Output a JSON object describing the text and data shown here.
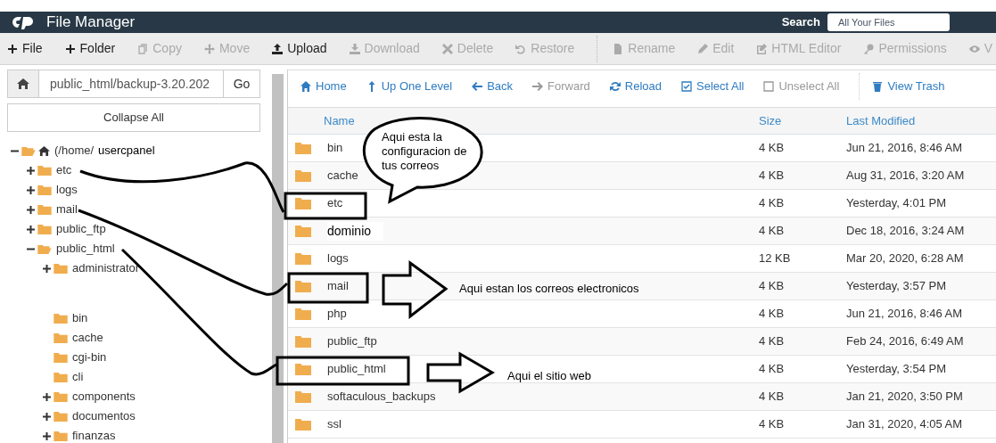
{
  "header": {
    "title": "File Manager",
    "search_label": "Search",
    "search_scope": "All Your Files"
  },
  "toolbar": [
    {
      "label": "File",
      "disabled": false
    },
    {
      "label": "Folder",
      "disabled": false
    },
    {
      "label": "Copy",
      "disabled": true
    },
    {
      "label": "Move",
      "disabled": true
    },
    {
      "label": "Upload",
      "disabled": false
    },
    {
      "label": "Download",
      "disabled": true
    },
    {
      "label": "Delete",
      "disabled": true
    },
    {
      "label": "Restore",
      "disabled": true
    },
    {
      "label": "Rename",
      "disabled": true
    },
    {
      "label": "Edit",
      "disabled": true
    },
    {
      "label": "HTML Editor",
      "disabled": true
    },
    {
      "label": "Permissions",
      "disabled": true
    },
    {
      "label": "V",
      "disabled": true
    }
  ],
  "path_field": {
    "value": "public_html/backup-3.20.202",
    "go": "Go"
  },
  "collapse_all": "Collapse All",
  "tree": {
    "label": "(/home/",
    "user": "usercpanel",
    "kind": "expanded",
    "children": [
      {
        "label": "etc",
        "kind": "collapsed"
      },
      {
        "label": "logs",
        "kind": "collapsed"
      },
      {
        "label": "mail",
        "kind": "collapsed"
      },
      {
        "label": "public_ftp",
        "kind": "collapsed"
      },
      {
        "label": "public_html",
        "kind": "expanded",
        "children": [
          {
            "label": "administrator",
            "kind": "collapsed"
          },
          {
            "label": "bin",
            "kind": "leaf",
            "spaced": true
          },
          {
            "label": "cache",
            "kind": "leaf"
          },
          {
            "label": "cgi-bin",
            "kind": "leaf"
          },
          {
            "label": "cli",
            "kind": "leaf"
          },
          {
            "label": "components",
            "kind": "collapsed"
          },
          {
            "label": "documentos",
            "kind": "collapsed"
          },
          {
            "label": "finanzas",
            "kind": "collapsed"
          }
        ]
      }
    ]
  },
  "nav": [
    {
      "label": "Home",
      "disabled": false
    },
    {
      "label": "Up One Level",
      "disabled": false
    },
    {
      "label": "Back",
      "disabled": false
    },
    {
      "label": "Forward",
      "disabled": true
    },
    {
      "label": "Reload",
      "disabled": false
    },
    {
      "label": "Select All",
      "disabled": false
    },
    {
      "label": "Unselect All",
      "disabled": true
    },
    {
      "label": "View Trash",
      "disabled": false
    }
  ],
  "table": {
    "columns": [
      "Name",
      "Size",
      "Last Modified"
    ],
    "rows": [
      {
        "name": "bin",
        "size": "4 KB",
        "modified": "Jun 21, 2016, 8:46 AM",
        "edited": false
      },
      {
        "name": "cache",
        "size": "4 KB",
        "modified": "Aug 31, 2016, 3:20 AM",
        "edited": false
      },
      {
        "name": "etc",
        "size": "4 KB",
        "modified": "Yesterday, 4:01 PM",
        "edited": false
      },
      {
        "name": "dominio",
        "size": "4 KB",
        "modified": "Dec 18, 2016, 3:24 AM",
        "edited": true
      },
      {
        "name": "logs",
        "size": "12 KB",
        "modified": "Mar 20, 2020, 6:28 AM",
        "edited": false
      },
      {
        "name": "mail",
        "size": "4 KB",
        "modified": "Yesterday, 3:57 PM",
        "edited": false
      },
      {
        "name": "php",
        "size": "4 KB",
        "modified": "Jun 21, 2016, 8:46 AM",
        "edited": false
      },
      {
        "name": "public_ftp",
        "size": "4 KB",
        "modified": "Feb 24, 2016, 6:49 AM",
        "edited": false
      },
      {
        "name": "public_html",
        "size": "4 KB",
        "modified": "Yesterday, 3:54 PM",
        "edited": false
      },
      {
        "name": "softaculous_backups",
        "size": "4 KB",
        "modified": "Jan 21, 2020, 3:50 PM",
        "edited": false
      },
      {
        "name": "ssl",
        "size": "4 KB",
        "modified": "Jan 31, 2020, 4:05 AM",
        "edited": false
      }
    ]
  },
  "annotations": {
    "bubble": "Aqui esta la configuracion de tus correos",
    "mail_note": "Aqui estan los correos electronicos",
    "web_note": "Aqui el sitio web"
  }
}
